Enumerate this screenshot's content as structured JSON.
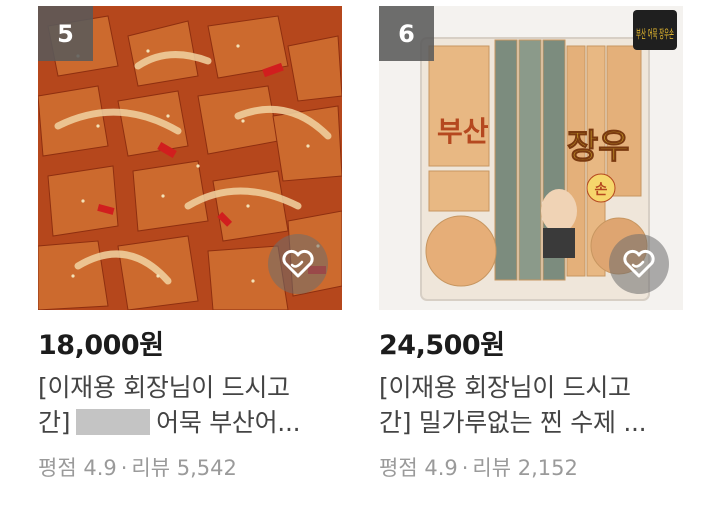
{
  "products": [
    {
      "rank": "5",
      "price": "18,000원",
      "title_line1": "[이재용 회장님이 드시고",
      "title_line2_prefix": "간]",
      "title_line2_suffix": "어묵 부산어...",
      "rating_label": "평점",
      "rating": "4.9",
      "separator": "·",
      "review_label": "리뷰",
      "review_count": "5,542",
      "image_icon": "spicy-fishcake-stirfry-photo"
    },
    {
      "rank": "6",
      "price": "24,500원",
      "title_line1": "[이재용 회장님이 드시고",
      "title_line2": "간] 밀가루없는 찐 수제 ...",
      "rating_label": "평점",
      "rating": "4.9",
      "separator": "·",
      "review_label": "리뷰",
      "review_count": "2,152",
      "image_icon": "packaged-fishcake-photo",
      "package_text_1": "부산",
      "package_text_2": "장우",
      "package_brand": "부산 어묵 장우손",
      "package_sub": "손"
    }
  ],
  "colors": {
    "rank_badge": "#5a5a5a",
    "price": "#1c1c1c",
    "title": "#444444",
    "meta": "#9a9a9a",
    "package_label": "#b5481f"
  },
  "icons": {
    "favorite": "heart-outline-icon"
  }
}
